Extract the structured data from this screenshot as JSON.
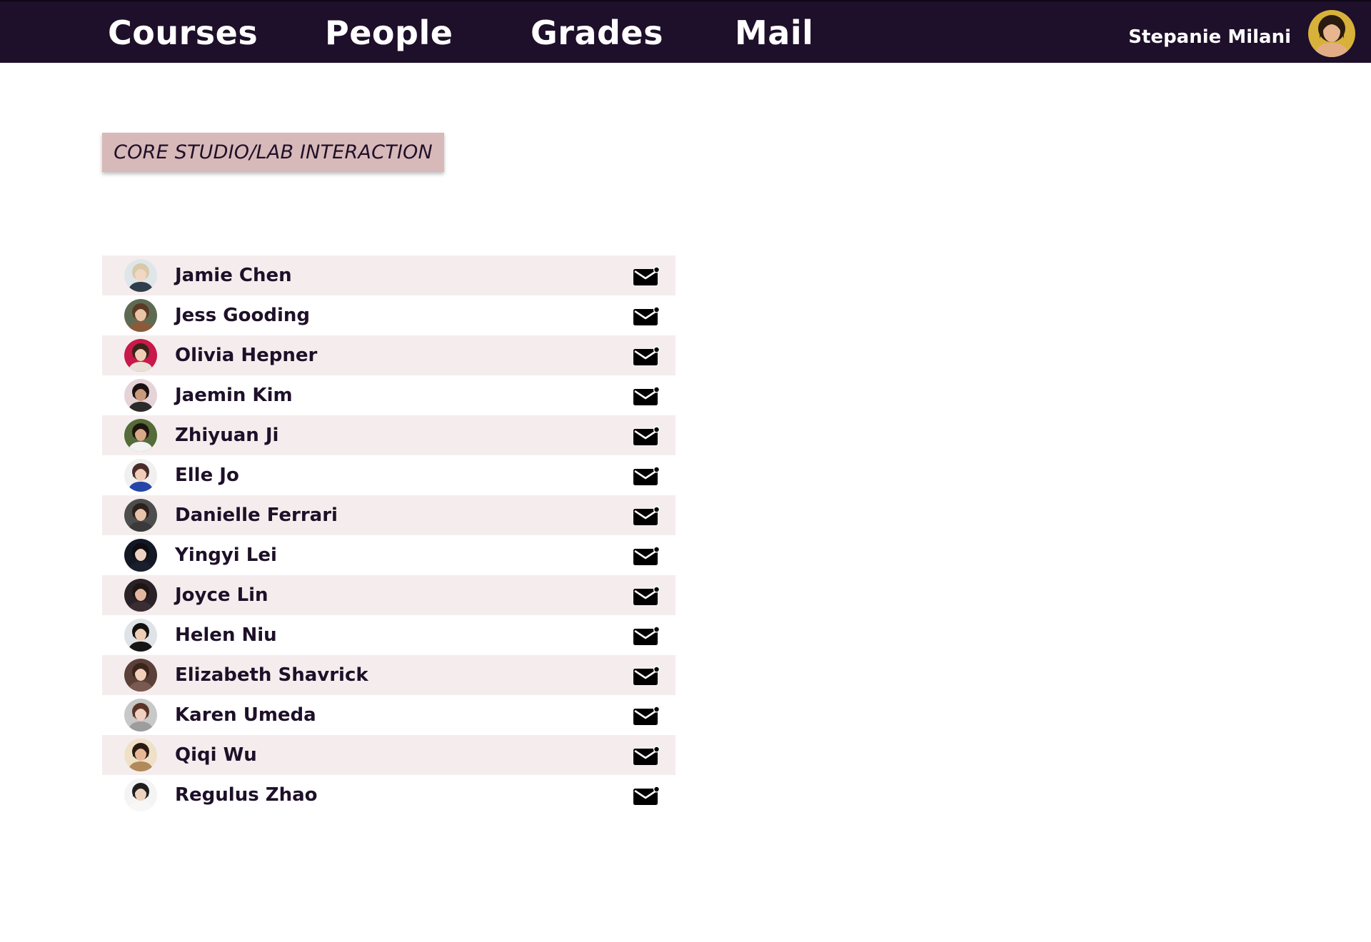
{
  "nav": {
    "items": [
      {
        "label": "Courses"
      },
      {
        "label": "People"
      },
      {
        "label": "Grades"
      },
      {
        "label": "Mail"
      }
    ]
  },
  "user": {
    "name": "Stepanie Milani",
    "avatar_icon": "user-avatar-photo"
  },
  "course": {
    "tag": "CORE STUDIO/LAB INTERACTION"
  },
  "people": [
    {
      "name": "Jamie Chen",
      "bg": "#dfe6ea",
      "hair": "#d9c9a8",
      "skin": "#f1d7c4",
      "shirt": "#2f3e4a"
    },
    {
      "name": "Jess Gooding",
      "bg": "#5e6b52",
      "hair": "#5a3a24",
      "skin": "#e9c3a6",
      "shirt": "#8b5a3b"
    },
    {
      "name": "Olivia Hepner",
      "bg": "#c9184a",
      "hair": "#3a2418",
      "skin": "#f1cdb5",
      "shirt": "#e8e1d8"
    },
    {
      "name": "Jaemin Kim",
      "bg": "#e6d3d8",
      "hair": "#1b1110",
      "skin": "#c99a7b",
      "shirt": "#2b2b2b"
    },
    {
      "name": "Zhiyuan Ji",
      "bg": "#556b3a",
      "hair": "#1d1410",
      "skin": "#d9a887",
      "shirt": "#f2f2f2"
    },
    {
      "name": "Elle Jo",
      "bg": "#f0f0f0",
      "hair": "#4a2b2a",
      "skin": "#f0cdb6",
      "shirt": "#2545a8"
    },
    {
      "name": "Danielle Ferrari",
      "bg": "#4d4d4d",
      "hair": "#2d211c",
      "skin": "#e8c4ab",
      "shirt": "#3a3a3a"
    },
    {
      "name": "Yingyi Lei",
      "bg": "#141824",
      "hair": "#0d0d12",
      "skin": "#efd2c1",
      "shirt": "#1a1f2e"
    },
    {
      "name": "Joyce Lin",
      "bg": "#2a2226",
      "hair": "#1f1512",
      "skin": "#e2b9a0",
      "shirt": "#3b2e33"
    },
    {
      "name": "Helen Niu",
      "bg": "#dfe3e8",
      "hair": "#111111",
      "skin": "#efcdb6",
      "shirt": "#151515"
    },
    {
      "name": "Elizabeth Shavrick",
      "bg": "#5a4038",
      "hair": "#3b241b",
      "skin": "#f2d0ba",
      "shirt": "#7a5a50"
    },
    {
      "name": "Karen Umeda",
      "bg": "#c8c8c8",
      "hair": "#5a3327",
      "skin": "#f0d0c0",
      "shirt": "#9d9d9d"
    },
    {
      "name": "Qiqi Wu",
      "bg": "#efe1c8",
      "hair": "#2a1a12",
      "skin": "#e8b896",
      "shirt": "#b08a5a"
    },
    {
      "name": "Regulus Zhao",
      "bg": "#f4f4f4",
      "hair": "#1e1e1e",
      "skin": "#efd2bd",
      "shirt": "#f7f7f7"
    }
  ],
  "icons": {
    "row_action": "mail-icon",
    "row_avatar": "profile-photo"
  },
  "colors": {
    "topbar": "#1e0f2a",
    "tag_bg": "#d8b9b9",
    "row_shade": "#f5eded",
    "text": "#1e1029"
  }
}
